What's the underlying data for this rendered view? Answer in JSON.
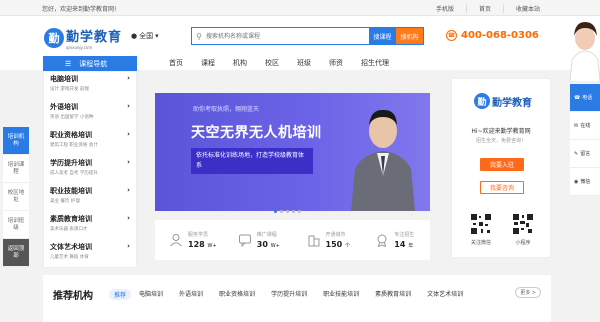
{
  "topbar": {
    "welcome": "您好，欢迎来到勤学教育网!",
    "links": [
      "手机版",
      "首页",
      "收藏本站"
    ]
  },
  "header": {
    "logo_cn": "勤学教育",
    "logo_en": "qinxuejy.com",
    "city": "全国",
    "search_placeholder": "搜索机构名称或课程",
    "search_course_btn": "搜课程",
    "search_org_btn": "搜机构",
    "phone": "400-068-0306"
  },
  "nav": {
    "course_nav": "课程导航",
    "items": [
      "首页",
      "课程",
      "机构",
      "校区",
      "班级",
      "师资",
      "招生代理"
    ]
  },
  "categories": [
    {
      "title": "电脑培训",
      "sub": "设计  游戏开发  前端"
    },
    {
      "title": "外语培训",
      "sub": "英语  出国留学  小语种"
    },
    {
      "title": "职业资格培训",
      "sub": "建筑工程  职业资格  会计"
    },
    {
      "title": "学历提升培训",
      "sub": "成人高考  自考  学历提升"
    },
    {
      "title": "职业技能培训",
      "sub": "美业  餐饮  护理"
    },
    {
      "title": "素质教育培训",
      "sub": "美术乐器  表演口才"
    },
    {
      "title": "文体艺术培训",
      "sub": "儿童艺术  舞蹈  体育"
    }
  ],
  "sidemenu": [
    "培训机构",
    "培训课程",
    "校区地址",
    "培训班级",
    "返回顶部"
  ],
  "banner": {
    "small": "助你考取执照，翱翔蓝天",
    "title": "天空无界无人机培训",
    "box": "依托标准化训练场地，打造学校级教育体系"
  },
  "stats": [
    {
      "label": "服务学员",
      "value": "128",
      "unit": "W+"
    },
    {
      "label": "推广课程",
      "value": "30",
      "unit": "W+"
    },
    {
      "label": "开通城市",
      "value": "150",
      "unit": "个"
    },
    {
      "label": "专注招生",
      "value": "14",
      "unit": "年"
    }
  ],
  "right_panel": {
    "logo_cn": "勤学教育",
    "welcome": "Hi~欢迎来勤学教育网",
    "sub": "招生全天，免费咨询！",
    "btn_join": "我要入驻",
    "btn_enroll": "我要咨询",
    "qr1": "关注微信",
    "qr2": "小程序"
  },
  "right_float": [
    "电话",
    "在线",
    "留言",
    "微信"
  ],
  "bottom": {
    "title": "推荐机构",
    "tabs": [
      "推荐",
      "电脑培训",
      "外语培训",
      "职业资格培训",
      "学历提升培训",
      "职业技能培训",
      "素质教育培训",
      "文体艺术培训"
    ],
    "more": "更多 >"
  }
}
